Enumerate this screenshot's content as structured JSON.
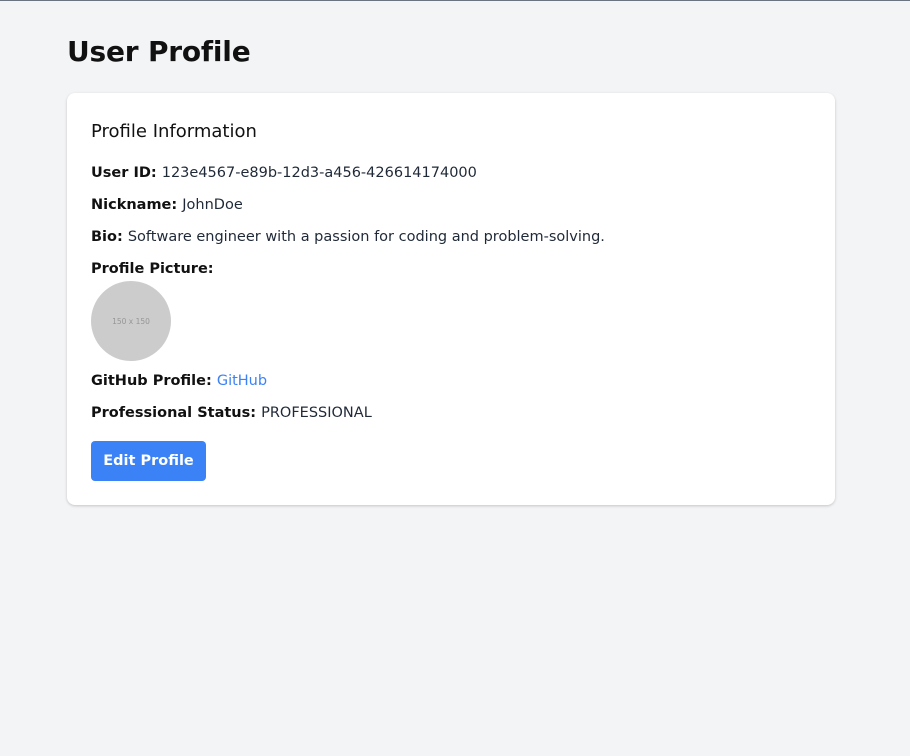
{
  "page": {
    "title": "User Profile"
  },
  "card": {
    "title": "Profile Information",
    "user_id": {
      "label": "User ID:",
      "value": "123e4567-e89b-12d3-a456-426614174000"
    },
    "nickname": {
      "label": "Nickname:",
      "value": "JohnDoe"
    },
    "bio": {
      "label": "Bio:",
      "value": "Software engineer with a passion for coding and problem-solving."
    },
    "profile_picture": {
      "label": "Profile Picture:",
      "placeholder_text": "150 x 150"
    },
    "github": {
      "label": "GitHub Profile:",
      "link_text": "GitHub"
    },
    "status": {
      "label": "Professional Status:",
      "value": "PROFESSIONAL"
    },
    "edit_button_label": "Edit Profile"
  },
  "colors": {
    "background": "#f3f4f6",
    "card": "#ffffff",
    "accent": "#3b82f6",
    "avatar_placeholder": "#cccccc"
  }
}
